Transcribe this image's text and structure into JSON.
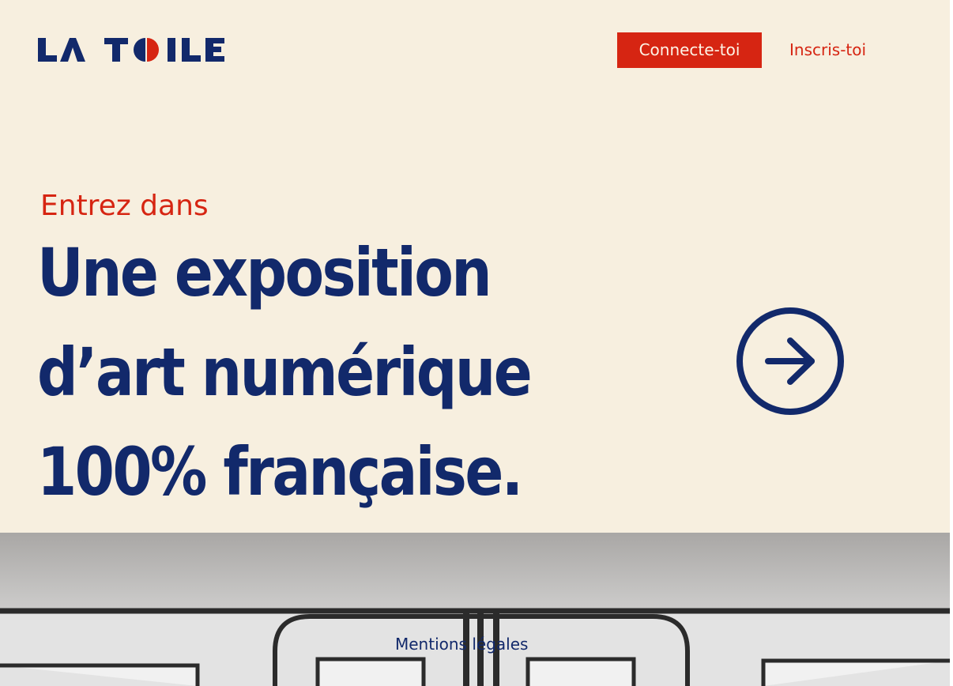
{
  "header": {
    "logo_text": "LA TOILE",
    "login_label": "Connecte-toi",
    "signup_label": "Inscris-toi"
  },
  "hero": {
    "kicker": "Entrez dans",
    "headline_lines": [
      "Une exposition",
      "d’art numérique",
      "100% française."
    ],
    "cta_icon": "arrow-right-circle-icon"
  },
  "footer": {
    "legal_label": "Mentions légales"
  },
  "colors": {
    "background": "#f7efdf",
    "navy": "#12296b",
    "red": "#d62512"
  }
}
